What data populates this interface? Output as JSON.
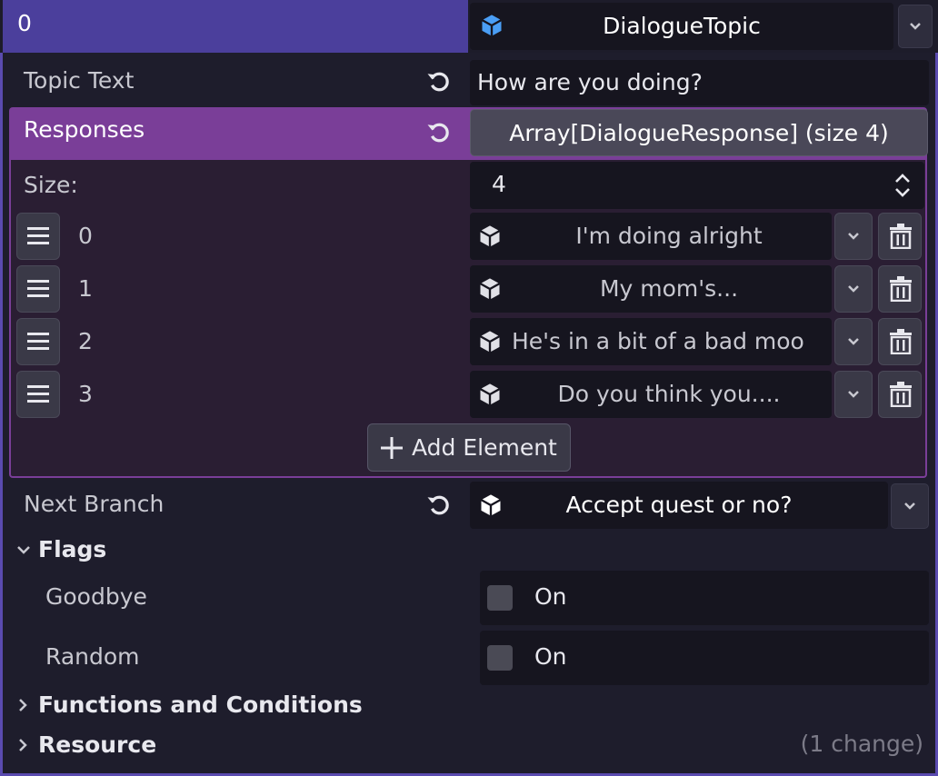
{
  "header": {
    "index": "0",
    "resource_type": "DialogueTopic",
    "cube_color": "#4a9ef5"
  },
  "topic_text": {
    "label": "Topic Text",
    "value": "How are you doing?"
  },
  "responses": {
    "label": "Responses",
    "array_summary": "Array[DialogueResponse] (size 4)",
    "size_label": "Size:",
    "size_value": "4",
    "items": [
      {
        "index": "0",
        "value": "I'm doing alright"
      },
      {
        "index": "1",
        "value": "My mom's..."
      },
      {
        "index": "2",
        "value": "He's in a bit of a bad moo"
      },
      {
        "index": "3",
        "value": "Do you think you...."
      }
    ],
    "add_label": "Add Element"
  },
  "next_branch": {
    "label": "Next Branch",
    "value": "Accept quest or no?"
  },
  "flags": {
    "title": "Flags",
    "goodbye": {
      "label": "Goodbye",
      "check_label": "On"
    },
    "random": {
      "label": "Random",
      "check_label": "On"
    }
  },
  "functions_section": "Functions and Conditions",
  "resource_section": "Resource",
  "change_count": "(1 change)",
  "colors": {
    "header_bg": "#4b3f9c",
    "responses_accent": "#7a3e98",
    "panel_bg": "#1e1d2c"
  }
}
